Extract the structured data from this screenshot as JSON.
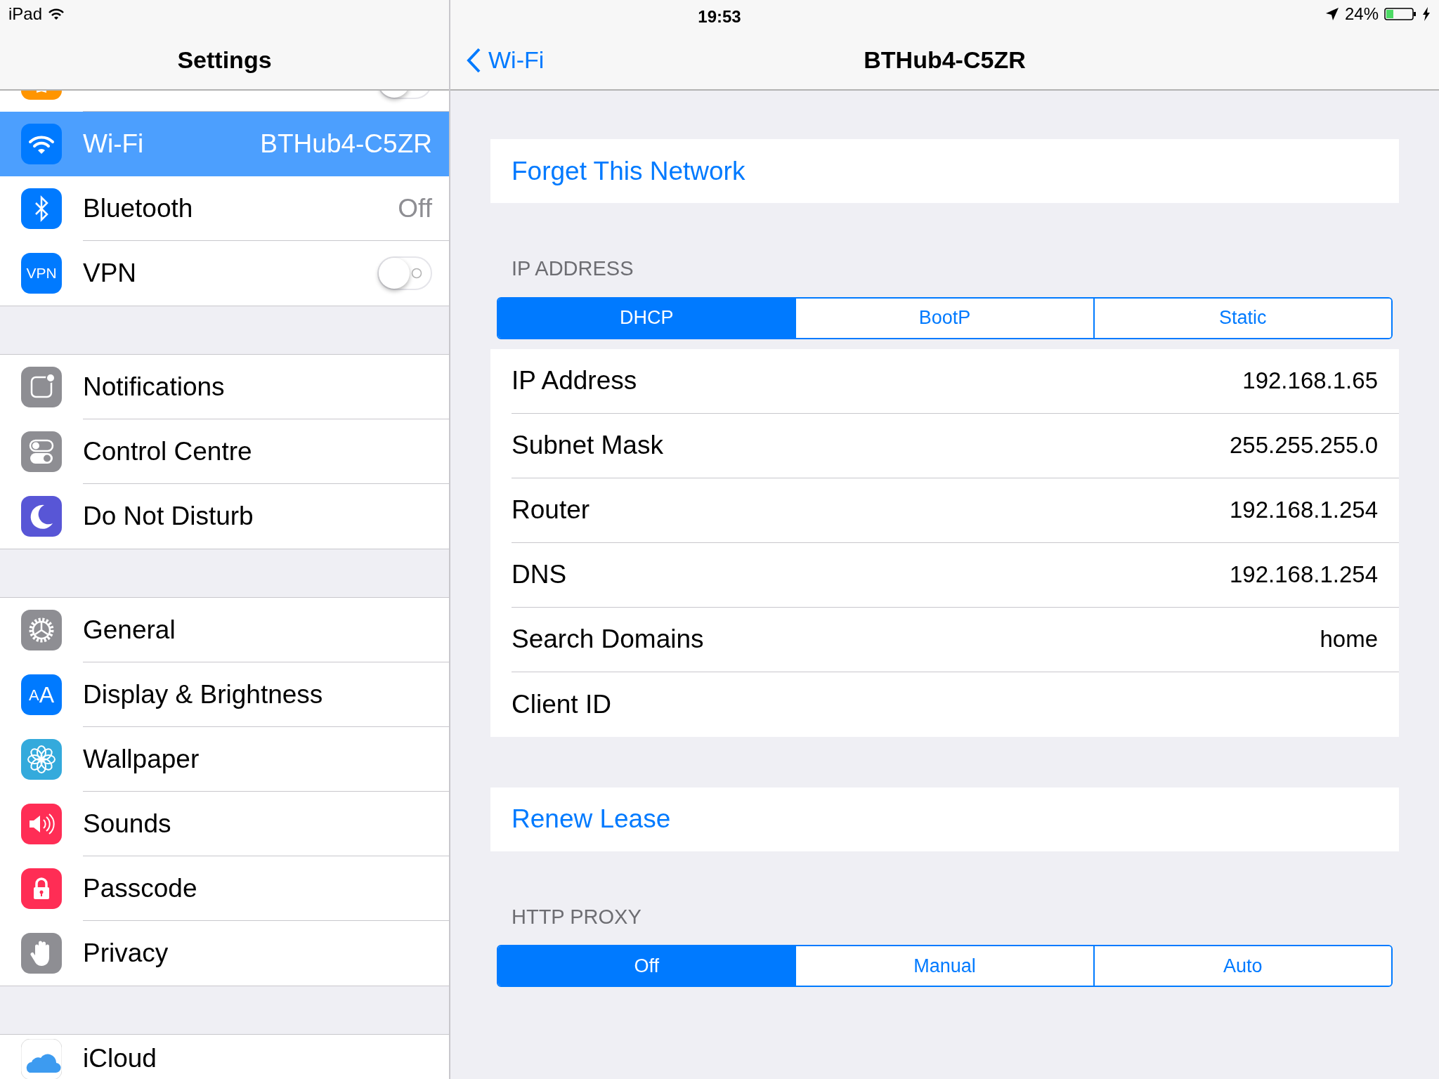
{
  "status_bar": {
    "device": "iPad",
    "time": "19:53",
    "battery_text": "24%"
  },
  "sidebar": {
    "title": "Settings",
    "groups": [
      {
        "items": [
          {
            "kind": "toggle",
            "on": false,
            "selected": false
          },
          {
            "kind": "value",
            "label": "Wi-Fi",
            "value": "BTHub4-C5ZR",
            "selected": true
          },
          {
            "kind": "value",
            "label": "Bluetooth",
            "value": "Off",
            "selected": false
          },
          {
            "kind": "toggle",
            "label": "VPN",
            "icon_text": "VPN",
            "on": false,
            "selected": false
          }
        ]
      },
      {
        "items": [
          {
            "kind": "plain",
            "label": "Notifications",
            "selected": false
          },
          {
            "kind": "plain",
            "label": "Control Centre",
            "selected": false
          },
          {
            "kind": "plain",
            "label": "Do Not Disturb",
            "selected": false
          }
        ]
      },
      {
        "items": [
          {
            "kind": "plain",
            "label": "General",
            "selected": false
          },
          {
            "kind": "plain",
            "label": "Display & Brightness",
            "icon_text": "AA",
            "selected": false
          },
          {
            "kind": "plain",
            "label": "Wallpaper",
            "selected": false
          },
          {
            "kind": "plain",
            "label": "Sounds",
            "selected": false
          },
          {
            "kind": "plain",
            "label": "Passcode",
            "selected": false
          },
          {
            "kind": "plain",
            "label": "Privacy",
            "selected": false
          }
        ]
      },
      {
        "items": [
          {
            "kind": "plain",
            "label": "iCloud",
            "selected": false
          }
        ]
      }
    ]
  },
  "detail": {
    "back": "Wi-Fi",
    "title": "BTHub4-C5ZR",
    "forget": "Forget This Network",
    "ip_section": "IP ADDRESS",
    "ip_modes": [
      {
        "label": "DHCP",
        "selected": true
      },
      {
        "label": "BootP",
        "selected": false
      },
      {
        "label": "Static",
        "selected": false
      }
    ],
    "rows": [
      {
        "label": "IP Address",
        "value": "192.168.1.65"
      },
      {
        "label": "Subnet Mask",
        "value": "255.255.255.0"
      },
      {
        "label": "Router",
        "value": "192.168.1.254"
      },
      {
        "label": "DNS",
        "value": "192.168.1.254"
      },
      {
        "label": "Search Domains",
        "value": "home"
      },
      {
        "label": "Client ID"
      }
    ],
    "renew": "Renew Lease",
    "proxy_section": "HTTP PROXY",
    "proxy_modes": [
      {
        "label": "Off",
        "selected": true
      },
      {
        "label": "Manual",
        "selected": false
      },
      {
        "label": "Auto",
        "selected": false
      }
    ]
  }
}
